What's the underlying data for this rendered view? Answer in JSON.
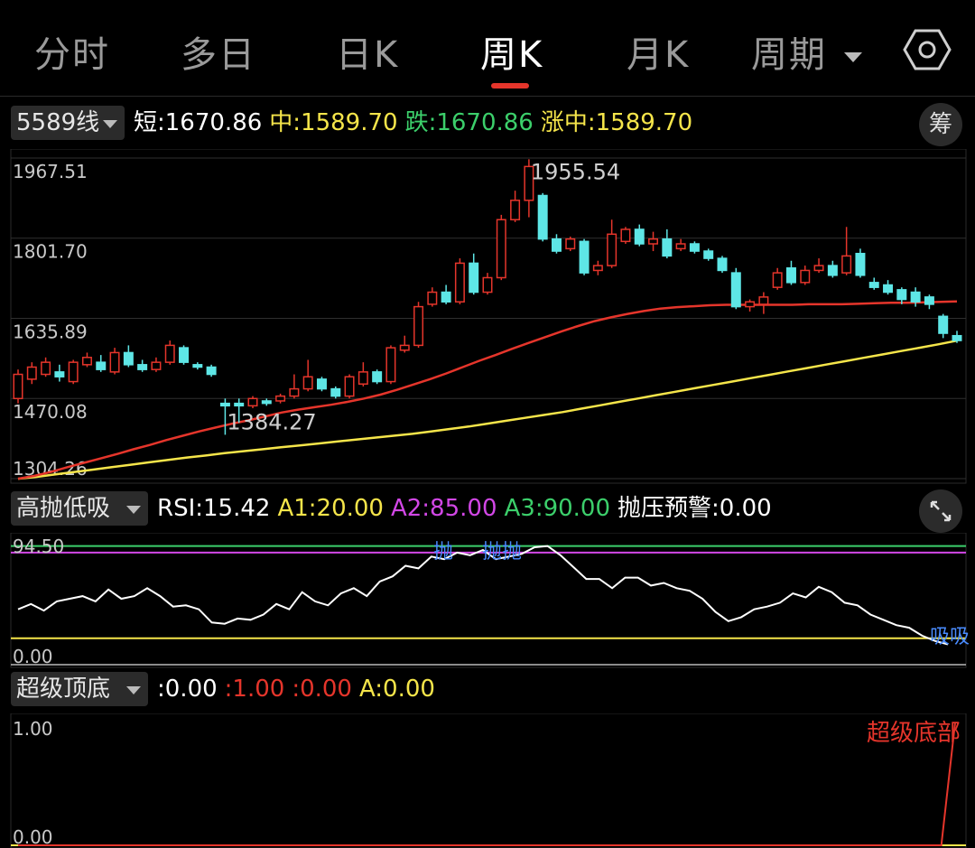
{
  "tabs": [
    {
      "label": "分时",
      "active": false
    },
    {
      "label": "多日",
      "active": false
    },
    {
      "label": "日K",
      "active": false
    },
    {
      "label": "周K",
      "active": true
    },
    {
      "label": "月K",
      "active": false
    },
    {
      "label": "周期",
      "active": false,
      "dropdown": true
    }
  ],
  "settings_icon": "hexagon-settings-icon",
  "main_panel": {
    "indicator": "5589线",
    "legend": [
      {
        "label": "短:1670.86",
        "color": "#ffffff"
      },
      {
        "label": "中:1589.70",
        "color": "#f5e54a"
      },
      {
        "label": "跌:1670.86",
        "color": "#3ccf6b"
      },
      {
        "label": "涨中:1589.70",
        "color": "#f5e54a"
      }
    ],
    "chip_button": "筹",
    "hi_label": "1955.54",
    "lo_label": "1384.27"
  },
  "rsi_panel": {
    "indicator": "高抛低吸",
    "legend": [
      {
        "label": "RSI:15.42",
        "color": "#ffffff"
      },
      {
        "label": "A1:20.00",
        "color": "#f5e54a"
      },
      {
        "label": "A2:85.00",
        "color": "#d247e6"
      },
      {
        "label": "A3:90.00",
        "color": "#3ccf6b"
      },
      {
        "label": "抛压预警:0.00",
        "color": "#ffffff"
      }
    ],
    "expand_icon": "expand-arrows-icon",
    "signals": [
      "抛",
      "抛抛",
      "吸吸"
    ]
  },
  "bottom_panel": {
    "indicator": "超级顶底",
    "legend": [
      {
        "label": ":0.00",
        "color": "#ffffff"
      },
      {
        "label": ":1.00",
        "color": "#e5352b"
      },
      {
        "label": ":0.00",
        "color": "#e5352b"
      },
      {
        "label": "A:0.00",
        "color": "#f5e54a"
      }
    ],
    "annotation": "超级底部"
  },
  "chart_data": [
    {
      "type": "candlestick",
      "title": "",
      "y_ticks": [
        1967.51,
        1801.7,
        1635.89,
        1470.08,
        1304.26
      ],
      "ylim": [
        1304.26,
        1967.51
      ],
      "candles": [
        [
          1470,
          1520,
          1460,
          1530
        ],
        [
          1510,
          1535,
          1500,
          1545
        ],
        [
          1520,
          1545,
          1515,
          1555
        ],
        [
          1525,
          1515,
          1505,
          1540
        ],
        [
          1505,
          1545,
          1500,
          1550
        ],
        [
          1540,
          1555,
          1535,
          1565
        ],
        [
          1545,
          1530,
          1525,
          1560
        ],
        [
          1525,
          1565,
          1520,
          1575
        ],
        [
          1565,
          1540,
          1535,
          1580
        ],
        [
          1540,
          1530,
          1525,
          1550
        ],
        [
          1530,
          1545,
          1525,
          1555
        ],
        [
          1545,
          1580,
          1540,
          1590
        ],
        [
          1575,
          1545,
          1540,
          1580
        ],
        [
          1540,
          1535,
          1530,
          1545
        ],
        [
          1535,
          1520,
          1515,
          1540
        ],
        [
          1460,
          1455,
          1395,
          1470
        ],
        [
          1460,
          1455,
          1420,
          1470
        ],
        [
          1455,
          1470,
          1450,
          1475
        ],
        [
          1465,
          1460,
          1455,
          1470
        ],
        [
          1465,
          1475,
          1460,
          1480
        ],
        [
          1475,
          1490,
          1470,
          1520
        ],
        [
          1490,
          1515,
          1485,
          1550
        ],
        [
          1510,
          1490,
          1485,
          1515
        ],
        [
          1490,
          1475,
          1470,
          1495
        ],
        [
          1475,
          1515,
          1470,
          1520
        ],
        [
          1500,
          1525,
          1495,
          1545
        ],
        [
          1525,
          1505,
          1500,
          1530
        ],
        [
          1505,
          1575,
          1500,
          1580
        ],
        [
          1570,
          1580,
          1565,
          1600
        ],
        [
          1580,
          1660,
          1575,
          1670
        ],
        [
          1665,
          1690,
          1660,
          1700
        ],
        [
          1690,
          1670,
          1665,
          1705
        ],
        [
          1670,
          1750,
          1665,
          1760
        ],
        [
          1750,
          1690,
          1685,
          1770
        ],
        [
          1690,
          1720,
          1685,
          1730
        ],
        [
          1720,
          1840,
          1715,
          1850
        ],
        [
          1840,
          1880,
          1835,
          1900
        ],
        [
          1880,
          1950,
          1845,
          1965
        ],
        [
          1890,
          1800,
          1795,
          1895
        ],
        [
          1800,
          1775,
          1770,
          1810
        ],
        [
          1780,
          1800,
          1775,
          1805
        ],
        [
          1795,
          1730,
          1725,
          1800
        ],
        [
          1735,
          1745,
          1725,
          1755
        ],
        [
          1745,
          1810,
          1740,
          1840
        ],
        [
          1795,
          1820,
          1790,
          1825
        ],
        [
          1820,
          1790,
          1785,
          1830
        ],
        [
          1790,
          1800,
          1775,
          1815
        ],
        [
          1800,
          1765,
          1760,
          1820
        ],
        [
          1780,
          1790,
          1775,
          1800
        ],
        [
          1790,
          1775,
          1770,
          1795
        ],
        [
          1775,
          1760,
          1755,
          1780
        ],
        [
          1760,
          1735,
          1730,
          1765
        ],
        [
          1730,
          1660,
          1655,
          1740
        ],
        [
          1660,
          1670,
          1650,
          1675
        ],
        [
          1665,
          1680,
          1645,
          1690
        ],
        [
          1700,
          1730,
          1695,
          1740
        ],
        [
          1740,
          1710,
          1705,
          1755
        ],
        [
          1710,
          1735,
          1705,
          1745
        ],
        [
          1735,
          1745,
          1730,
          1760
        ],
        [
          1745,
          1725,
          1720,
          1755
        ],
        [
          1730,
          1765,
          1725,
          1825
        ],
        [
          1770,
          1725,
          1720,
          1780
        ],
        [
          1710,
          1700,
          1695,
          1720
        ],
        [
          1705,
          1690,
          1685,
          1715
        ],
        [
          1695,
          1675,
          1665,
          1700
        ],
        [
          1690,
          1670,
          1660,
          1700
        ],
        [
          1680,
          1665,
          1655,
          1685
        ],
        [
          1640,
          1605,
          1595,
          1645
        ],
        [
          1600,
          1590,
          1585,
          1610
        ]
      ],
      "short_line": [
        1304,
        1310,
        1318,
        1328,
        1337,
        1346,
        1355,
        1365,
        1374,
        1384,
        1393,
        1402,
        1410,
        1418,
        1425,
        1433,
        1441,
        1447,
        1452,
        1457,
        1463,
        1470,
        1478,
        1488,
        1499,
        1510,
        1522,
        1535,
        1548,
        1560,
        1573,
        1585,
        1597,
        1609,
        1620,
        1630,
        1638,
        1645,
        1651,
        1656,
        1659,
        1661,
        1663,
        1664,
        1664,
        1664,
        1664,
        1664,
        1665,
        1665,
        1665,
        1666,
        1667,
        1668,
        1668,
        1669,
        1670,
        1670.86
      ],
      "mid_line": [
        1304,
        1308,
        1313,
        1318,
        1323,
        1328,
        1333,
        1338,
        1343,
        1348,
        1352,
        1357,
        1361,
        1365,
        1369,
        1373,
        1377,
        1381,
        1385,
        1389,
        1393,
        1397,
        1402,
        1407,
        1412,
        1418,
        1424,
        1430,
        1436,
        1442,
        1449,
        1456,
        1463,
        1470,
        1477,
        1484,
        1491,
        1498,
        1505,
        1512,
        1519,
        1526,
        1533,
        1540,
        1547,
        1554,
        1561,
        1568,
        1575,
        1582,
        1589.7
      ]
    },
    {
      "type": "line",
      "title": "",
      "y_ticks": [
        94.5,
        0.0
      ],
      "ylim": [
        0,
        94.5
      ],
      "reference_lines": [
        {
          "name": "A1",
          "value": 20,
          "color": "#f5e54a"
        },
        {
          "name": "A2",
          "value": 85,
          "color": "#d247e6"
        },
        {
          "name": "A3",
          "value": 90,
          "color": "#3ccf6b"
        }
      ],
      "series": [
        {
          "name": "RSI",
          "color": "#ffffff",
          "values": [
            42,
            46,
            41,
            48,
            50,
            52,
            48,
            57,
            50,
            52,
            58,
            52,
            44,
            45,
            42,
            32,
            31,
            35,
            34,
            38,
            46,
            42,
            55,
            48,
            45,
            54,
            58,
            52,
            63,
            67,
            75,
            73,
            82,
            80,
            85,
            83,
            87,
            80,
            82,
            84,
            89,
            90,
            83,
            74,
            65,
            65,
            58,
            66,
            66,
            60,
            62,
            58,
            56,
            50,
            40,
            33,
            36,
            42,
            44,
            47,
            54,
            51,
            59,
            55,
            47,
            45,
            38,
            34,
            30,
            28,
            22,
            18,
            15.42
          ]
        }
      ]
    },
    {
      "type": "line",
      "title": "",
      "y_ticks": [
        1.0,
        0.0
      ],
      "ylim": [
        0,
        1
      ],
      "series": [
        {
          "name": "",
          "color": "#e5352b",
          "values": [
            0,
            0,
            0,
            0,
            0,
            0,
            0,
            0,
            0,
            0,
            0,
            0,
            0,
            0,
            0,
            0,
            0,
            0,
            0,
            0,
            0,
            0,
            0,
            0,
            0,
            0,
            0,
            0,
            0,
            0,
            0,
            0,
            0,
            0,
            0,
            0,
            0,
            0,
            0,
            0,
            0,
            0,
            0,
            0,
            0,
            0,
            0,
            0,
            0,
            0,
            0,
            0,
            0,
            0,
            0,
            0,
            0,
            0,
            0,
            0,
            0,
            0,
            0,
            0,
            0,
            0,
            0,
            0,
            1
          ]
        }
      ]
    }
  ]
}
